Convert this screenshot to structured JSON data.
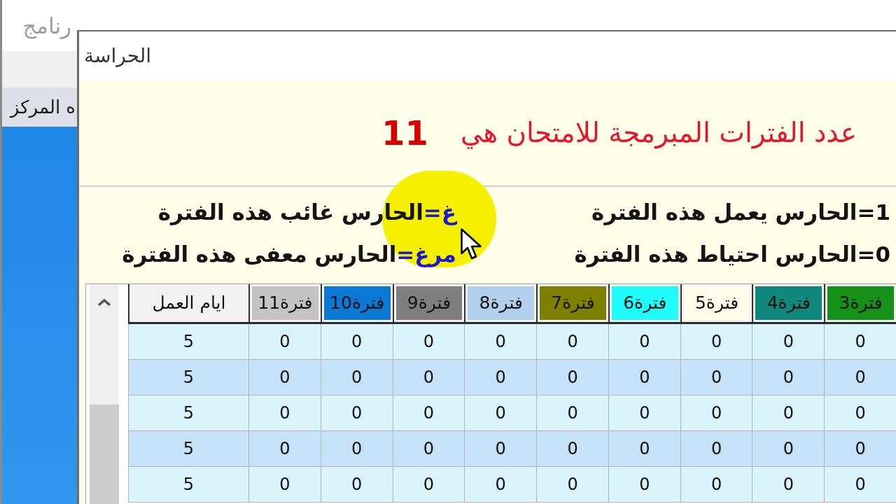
{
  "background_window": {
    "title": "رنامج",
    "item": "ه المركز"
  },
  "dialog": {
    "title": "الحراسة"
  },
  "periods_message": {
    "text": "عدد الفترات المبرمجة للامتحان هي",
    "count": "11"
  },
  "legend": [
    {
      "key": "1=",
      "description": "الحارس يعمل هذه الفترة",
      "color": "#111111"
    },
    {
      "key": "غ=",
      "description": "الحارس غائب هذه الفترة",
      "color": "#1a1acc"
    },
    {
      "key": "0=",
      "description": "الحارس احتياط هذه الفترة",
      "color": "#111111"
    },
    {
      "key": "مرغ=",
      "description": "الحارس معفى هذه الفترة",
      "color": "#1a1acc"
    }
  ],
  "table": {
    "columns": [
      {
        "label": "فترة3",
        "color": "#17901a"
      },
      {
        "label": "فترة4",
        "color": "#11887c"
      },
      {
        "label": "فترة5",
        "color": "#fffde9"
      },
      {
        "label": "فترة6",
        "color": "#1ffcfc"
      },
      {
        "label": "فترة7",
        "color": "#808000"
      },
      {
        "label": "فترة8",
        "color": "#b2d0ee"
      },
      {
        "label": "فترة9",
        "color": "#7f7f7f"
      },
      {
        "label": "فترة10",
        "color": "#0b78d4"
      },
      {
        "label": "فترة11",
        "color": "#c3c3c3"
      },
      {
        "label": "ايام العمل"
      }
    ],
    "rows": [
      [
        "0",
        "0",
        "0",
        "0",
        "0",
        "0",
        "0",
        "0",
        "0",
        "5"
      ],
      [
        "0",
        "0",
        "0",
        "0",
        "0",
        "0",
        "0",
        "0",
        "0",
        "5"
      ],
      [
        "0",
        "0",
        "0",
        "0",
        "0",
        "0",
        "0",
        "0",
        "0",
        "5"
      ],
      [
        "0",
        "0",
        "0",
        "0",
        "0",
        "0",
        "0",
        "0",
        "0",
        "5"
      ],
      [
        "0",
        "0",
        "0",
        "0",
        "0",
        "0",
        "0",
        "0",
        "0",
        "5"
      ]
    ]
  }
}
